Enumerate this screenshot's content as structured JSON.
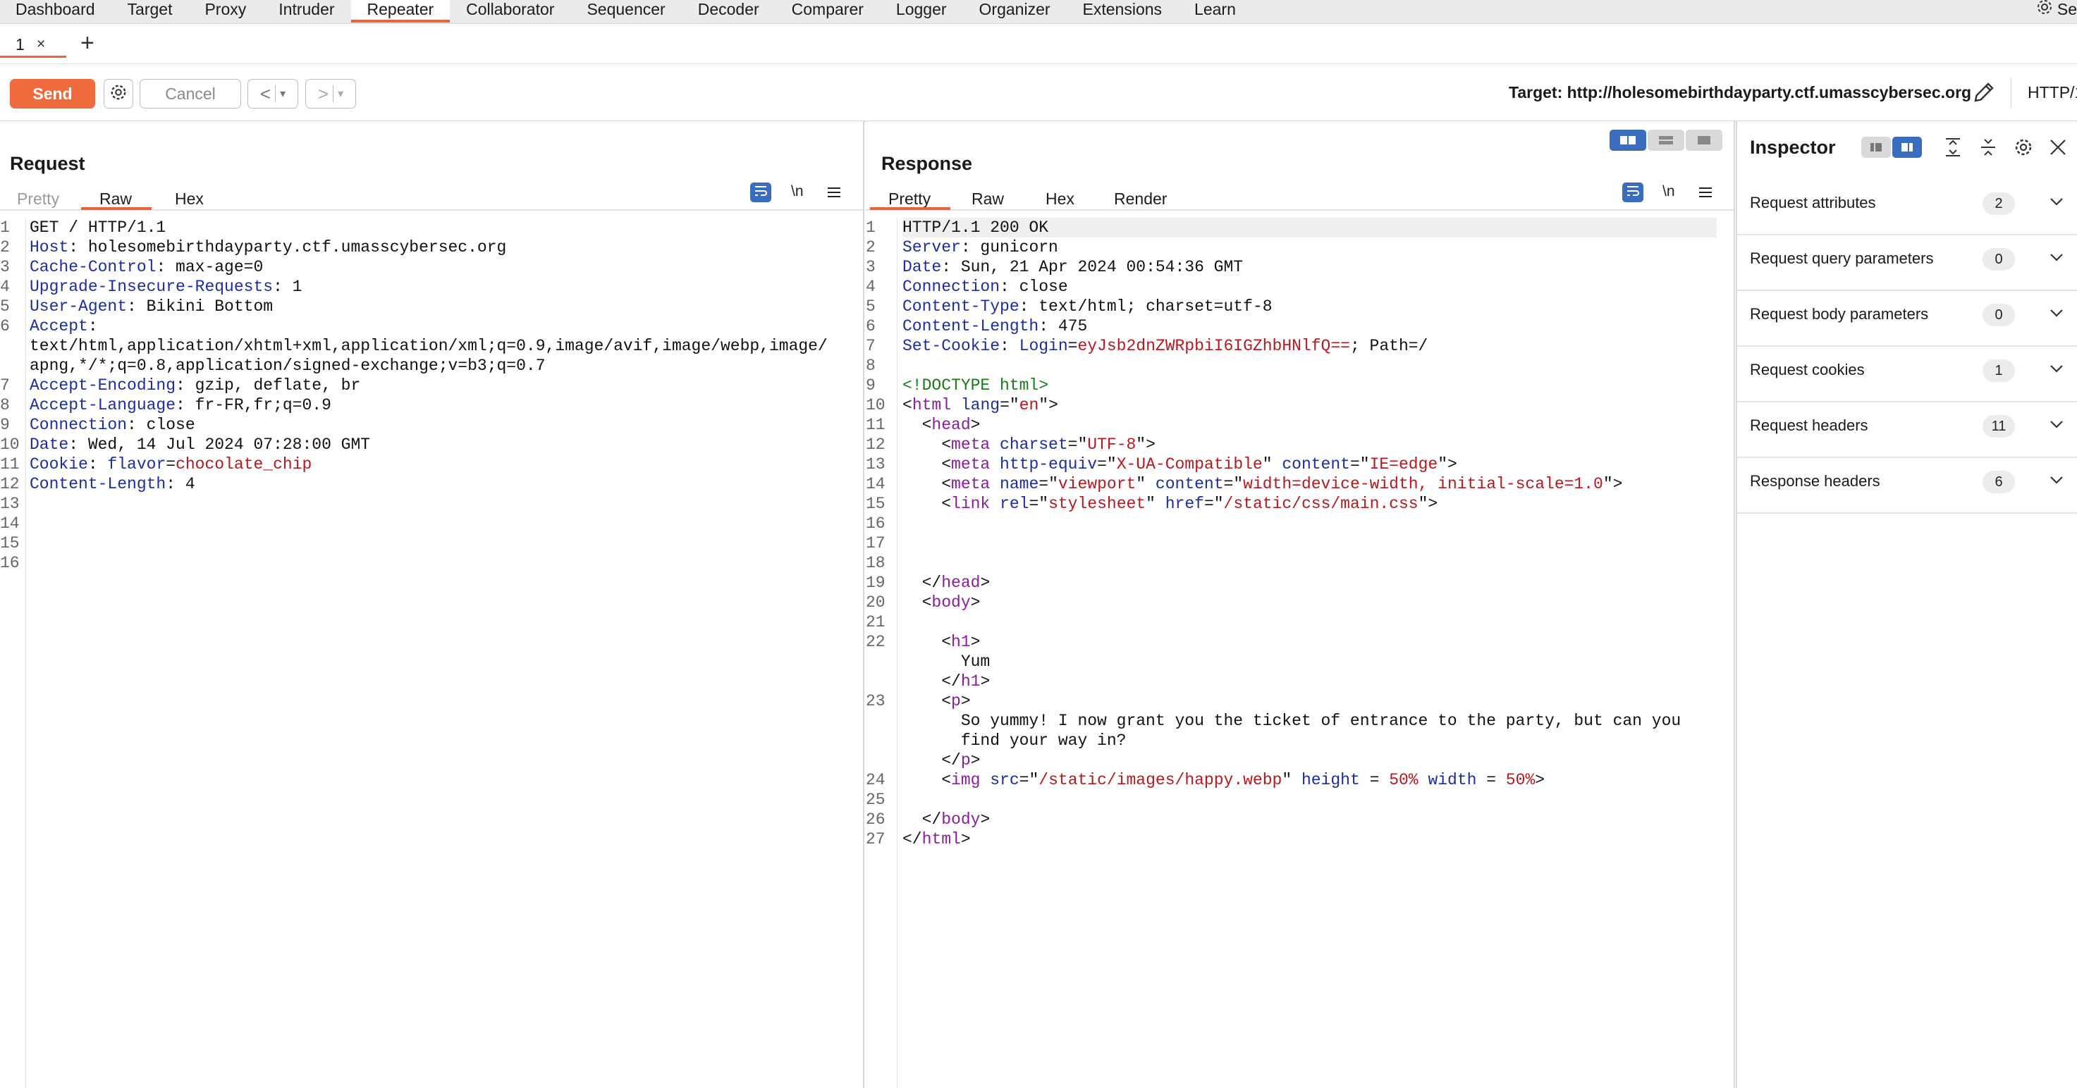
{
  "nav": {
    "tabs": [
      "Dashboard",
      "Target",
      "Proxy",
      "Intruder",
      "Repeater",
      "Collaborator",
      "Sequencer",
      "Decoder",
      "Comparer",
      "Logger",
      "Organizer",
      "Extensions",
      "Learn"
    ],
    "active": "Repeater",
    "settings_label": "Se"
  },
  "subtabs": {
    "tab1_label": "1",
    "tab1_close": "×",
    "add_label": "+"
  },
  "toolbar": {
    "send_label": "Send",
    "cancel_label": "Cancel",
    "prev_label": "<",
    "next_label": ">",
    "target_label": "Target: http://holesomebirthdayparty.ctf.umasscybersec.org",
    "http_version": "HTTP/1"
  },
  "request": {
    "title": "Request",
    "tabs": [
      "Pretty",
      "Raw",
      "Hex"
    ],
    "active_tab": "Raw",
    "newline_label": "\\n",
    "lines": [
      {
        "n": "1",
        "segs": [
          {
            "t": "GET / HTTP/1.1",
            "c": ""
          }
        ]
      },
      {
        "n": "2",
        "segs": [
          {
            "t": "Host",
            "c": "k"
          },
          {
            "t": ": holesomebirthdayparty.ctf.umasscybersec.org",
            "c": ""
          }
        ]
      },
      {
        "n": "3",
        "segs": [
          {
            "t": "Cache-Control",
            "c": "k"
          },
          {
            "t": ": max-age=0",
            "c": ""
          }
        ]
      },
      {
        "n": "4",
        "segs": [
          {
            "t": "Upgrade-Insecure-Requests",
            "c": "k"
          },
          {
            "t": ": 1",
            "c": ""
          }
        ]
      },
      {
        "n": "5",
        "segs": [
          {
            "t": "User-Agent",
            "c": "k"
          },
          {
            "t": ": Bikini Bottom",
            "c": ""
          }
        ]
      },
      {
        "n": "6",
        "segs": [
          {
            "t": "Accept",
            "c": "k"
          },
          {
            "t": ":",
            "c": ""
          }
        ]
      },
      {
        "n": "",
        "segs": [
          {
            "t": "text/html,application/xhtml+xml,application/xml;q=0.9,image/avif,image/webp,image/",
            "c": ""
          }
        ]
      },
      {
        "n": "",
        "segs": [
          {
            "t": "apng,*/*;q=0.8,application/signed-exchange;v=b3;q=0.7",
            "c": ""
          }
        ]
      },
      {
        "n": "7",
        "segs": [
          {
            "t": "Accept-Encoding",
            "c": "k"
          },
          {
            "t": ": gzip, deflate, br",
            "c": ""
          }
        ]
      },
      {
        "n": "8",
        "segs": [
          {
            "t": "Accept-Language",
            "c": "k"
          },
          {
            "t": ": fr-FR,fr;q=0.9",
            "c": ""
          }
        ]
      },
      {
        "n": "9",
        "segs": [
          {
            "t": "Connection",
            "c": "k"
          },
          {
            "t": ": close",
            "c": ""
          }
        ]
      },
      {
        "n": "10",
        "segs": [
          {
            "t": "Date",
            "c": "k"
          },
          {
            "t": ": Wed, 14 Jul 2024 07:28:00 GMT",
            "c": ""
          }
        ]
      },
      {
        "n": "11",
        "segs": [
          {
            "t": "Cookie",
            "c": "k"
          },
          {
            "t": ": ",
            "c": ""
          },
          {
            "t": "flavor",
            "c": "k"
          },
          {
            "t": "=",
            "c": ""
          },
          {
            "t": "chocolate_chip",
            "c": "v"
          }
        ]
      },
      {
        "n": "12",
        "segs": [
          {
            "t": "Content-Length",
            "c": "k"
          },
          {
            "t": ": 4",
            "c": ""
          }
        ]
      },
      {
        "n": "13",
        "segs": [
          {
            "t": "",
            "c": ""
          }
        ],
        "hl": true
      },
      {
        "n": "14",
        "segs": [
          {
            "t": "",
            "c": ""
          }
        ]
      },
      {
        "n": "15",
        "segs": [
          {
            "t": "",
            "c": ""
          }
        ]
      },
      {
        "n": "16",
        "segs": [
          {
            "t": "",
            "c": ""
          }
        ]
      }
    ]
  },
  "response": {
    "title": "Response",
    "tabs": [
      "Pretty",
      "Raw",
      "Hex",
      "Render"
    ],
    "active_tab": "Pretty",
    "newline_label": "\\n",
    "lines": [
      {
        "n": "1",
        "segs": [
          {
            "t": "HTTP/1.1 200 OK",
            "c": ""
          }
        ],
        "hl": true
      },
      {
        "n": "2",
        "segs": [
          {
            "t": "Server",
            "c": "k"
          },
          {
            "t": ": gunicorn",
            "c": ""
          }
        ]
      },
      {
        "n": "3",
        "segs": [
          {
            "t": "Date",
            "c": "k"
          },
          {
            "t": ": Sun, 21 Apr 2024 00:54:36 GMT",
            "c": ""
          }
        ]
      },
      {
        "n": "4",
        "segs": [
          {
            "t": "Connection",
            "c": "k"
          },
          {
            "t": ": close",
            "c": ""
          }
        ]
      },
      {
        "n": "5",
        "segs": [
          {
            "t": "Content-Type",
            "c": "k"
          },
          {
            "t": ": text/html; charset=utf-8",
            "c": ""
          }
        ]
      },
      {
        "n": "6",
        "segs": [
          {
            "t": "Content-Length",
            "c": "k"
          },
          {
            "t": ": 475",
            "c": ""
          }
        ]
      },
      {
        "n": "7",
        "segs": [
          {
            "t": "Set-Cookie",
            "c": "k"
          },
          {
            "t": ": ",
            "c": ""
          },
          {
            "t": "Login",
            "c": "k"
          },
          {
            "t": "=",
            "c": ""
          },
          {
            "t": "eyJsb2dnZWRpbiI6IGZhbHNlfQ==",
            "c": "v"
          },
          {
            "t": "; Path=/",
            "c": ""
          }
        ]
      },
      {
        "n": "8",
        "segs": [
          {
            "t": "",
            "c": ""
          }
        ]
      },
      {
        "n": "9",
        "segs": [
          {
            "t": "<!DOCTYPE html>",
            "c": "g"
          }
        ]
      },
      {
        "n": "10",
        "segs": [
          {
            "t": "<",
            "c": ""
          },
          {
            "t": "html",
            "c": "t"
          },
          {
            "t": " ",
            "c": ""
          },
          {
            "t": "lang",
            "c": "k"
          },
          {
            "t": "=\"",
            "c": ""
          },
          {
            "t": "en",
            "c": "v"
          },
          {
            "t": "\">",
            "c": ""
          }
        ]
      },
      {
        "n": "11",
        "segs": [
          {
            "t": "  <",
            "c": ""
          },
          {
            "t": "head",
            "c": "t"
          },
          {
            "t": ">",
            "c": ""
          }
        ]
      },
      {
        "n": "12",
        "segs": [
          {
            "t": "    <",
            "c": ""
          },
          {
            "t": "meta",
            "c": "t"
          },
          {
            "t": " ",
            "c": ""
          },
          {
            "t": "charset",
            "c": "k"
          },
          {
            "t": "=\"",
            "c": ""
          },
          {
            "t": "UTF-8",
            "c": "v"
          },
          {
            "t": "\">",
            "c": ""
          }
        ]
      },
      {
        "n": "13",
        "segs": [
          {
            "t": "    <",
            "c": ""
          },
          {
            "t": "meta",
            "c": "t"
          },
          {
            "t": " ",
            "c": ""
          },
          {
            "t": "http-equiv",
            "c": "k"
          },
          {
            "t": "=\"",
            "c": ""
          },
          {
            "t": "X-UA-Compatible",
            "c": "v"
          },
          {
            "t": "\" ",
            "c": ""
          },
          {
            "t": "content",
            "c": "k"
          },
          {
            "t": "=\"",
            "c": ""
          },
          {
            "t": "IE=edge",
            "c": "v"
          },
          {
            "t": "\">",
            "c": ""
          }
        ]
      },
      {
        "n": "14",
        "segs": [
          {
            "t": "    <",
            "c": ""
          },
          {
            "t": "meta",
            "c": "t"
          },
          {
            "t": " ",
            "c": ""
          },
          {
            "t": "name",
            "c": "k"
          },
          {
            "t": "=\"",
            "c": ""
          },
          {
            "t": "viewport",
            "c": "v"
          },
          {
            "t": "\" ",
            "c": ""
          },
          {
            "t": "content",
            "c": "k"
          },
          {
            "t": "=\"",
            "c": ""
          },
          {
            "t": "width=device-width, initial-scale=1.0",
            "c": "v"
          },
          {
            "t": "\">",
            "c": ""
          }
        ]
      },
      {
        "n": "15",
        "segs": [
          {
            "t": "    <",
            "c": ""
          },
          {
            "t": "link",
            "c": "t"
          },
          {
            "t": " ",
            "c": ""
          },
          {
            "t": "rel",
            "c": "k"
          },
          {
            "t": "=\"",
            "c": ""
          },
          {
            "t": "stylesheet",
            "c": "v"
          },
          {
            "t": "\" ",
            "c": ""
          },
          {
            "t": "href",
            "c": "k"
          },
          {
            "t": "=\"",
            "c": ""
          },
          {
            "t": "/static/css/main.css",
            "c": "v"
          },
          {
            "t": "\">",
            "c": ""
          }
        ]
      },
      {
        "n": "16",
        "segs": [
          {
            "t": "",
            "c": ""
          }
        ]
      },
      {
        "n": "17",
        "segs": [
          {
            "t": "",
            "c": ""
          }
        ]
      },
      {
        "n": "18",
        "segs": [
          {
            "t": "",
            "c": ""
          }
        ]
      },
      {
        "n": "19",
        "segs": [
          {
            "t": "  </",
            "c": ""
          },
          {
            "t": "head",
            "c": "t"
          },
          {
            "t": ">",
            "c": ""
          }
        ]
      },
      {
        "n": "20",
        "segs": [
          {
            "t": "  <",
            "c": ""
          },
          {
            "t": "body",
            "c": "t"
          },
          {
            "t": ">",
            "c": ""
          }
        ]
      },
      {
        "n": "21",
        "segs": [
          {
            "t": "",
            "c": ""
          }
        ]
      },
      {
        "n": "22",
        "segs": [
          {
            "t": "    <",
            "c": ""
          },
          {
            "t": "h1",
            "c": "t"
          },
          {
            "t": ">",
            "c": ""
          }
        ]
      },
      {
        "n": "",
        "segs": [
          {
            "t": "      Yum",
            "c": ""
          }
        ]
      },
      {
        "n": "",
        "segs": [
          {
            "t": "    </",
            "c": ""
          },
          {
            "t": "h1",
            "c": "t"
          },
          {
            "t": ">",
            "c": ""
          }
        ]
      },
      {
        "n": "23",
        "segs": [
          {
            "t": "    <",
            "c": ""
          },
          {
            "t": "p",
            "c": "t"
          },
          {
            "t": ">",
            "c": ""
          }
        ]
      },
      {
        "n": "",
        "segs": [
          {
            "t": "      So yummy! I now grant you the ticket of entrance to the party, but can you",
            "c": ""
          }
        ]
      },
      {
        "n": "",
        "segs": [
          {
            "t": "      find your way in?",
            "c": ""
          }
        ]
      },
      {
        "n": "",
        "segs": [
          {
            "t": "    </",
            "c": ""
          },
          {
            "t": "p",
            "c": "t"
          },
          {
            "t": ">",
            "c": ""
          }
        ]
      },
      {
        "n": "24",
        "segs": [
          {
            "t": "    <",
            "c": ""
          },
          {
            "t": "img",
            "c": "t"
          },
          {
            "t": " ",
            "c": ""
          },
          {
            "t": "src",
            "c": "k"
          },
          {
            "t": "=\"",
            "c": ""
          },
          {
            "t": "/static/images/happy.webp",
            "c": "v"
          },
          {
            "t": "\" ",
            "c": ""
          },
          {
            "t": "height",
            "c": "k"
          },
          {
            "t": " = ",
            "c": ""
          },
          {
            "t": "50%",
            "c": "v"
          },
          {
            "t": " ",
            "c": ""
          },
          {
            "t": "width",
            "c": "k"
          },
          {
            "t": " = ",
            "c": ""
          },
          {
            "t": "50%",
            "c": "v"
          },
          {
            "t": ">",
            "c": ""
          }
        ]
      },
      {
        "n": "25",
        "segs": [
          {
            "t": "",
            "c": ""
          }
        ]
      },
      {
        "n": "26",
        "segs": [
          {
            "t": "  </",
            "c": ""
          },
          {
            "t": "body",
            "c": "t"
          },
          {
            "t": ">",
            "c": ""
          }
        ]
      },
      {
        "n": "27",
        "segs": [
          {
            "t": "</",
            "c": ""
          },
          {
            "t": "html",
            "c": "t"
          },
          {
            "t": ">",
            "c": ""
          }
        ]
      }
    ]
  },
  "inspector": {
    "title": "Inspector",
    "rows": [
      {
        "label": "Request attributes",
        "count": "2"
      },
      {
        "label": "Request query parameters",
        "count": "0"
      },
      {
        "label": "Request body parameters",
        "count": "0"
      },
      {
        "label": "Request cookies",
        "count": "1"
      },
      {
        "label": "Request headers",
        "count": "11"
      },
      {
        "label": "Response headers",
        "count": "6"
      }
    ]
  },
  "colors": {
    "accent": "#e8643c",
    "send_button": "#ef6a3c",
    "toggle_active": "#3a6dbd",
    "header_key": "#1c2da1",
    "value": "#b6181d",
    "tag": "#8a1e9a",
    "doctype": "#1a7a1a"
  }
}
